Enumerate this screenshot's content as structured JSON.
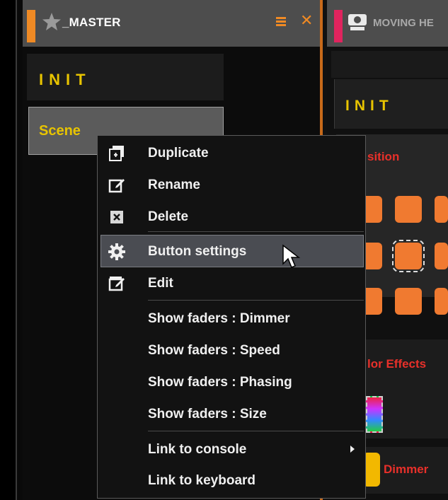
{
  "left_panel": {
    "title": "_MASTER",
    "buttons": [
      {
        "label": "INIT"
      },
      {
        "label": "Scene"
      }
    ],
    "accent_color": "#f08a24"
  },
  "right_panel": {
    "title": "MOVING HE",
    "init_label": "INIT",
    "position_label": "sition",
    "color_effects_label": "lor Effects",
    "dimmer_label": "Dimmer",
    "accent_color": "#e0245e"
  },
  "context_menu": {
    "items": [
      {
        "label": "Duplicate",
        "icon": "duplicate-icon"
      },
      {
        "label": "Rename",
        "icon": "rename-icon"
      },
      {
        "label": "Delete",
        "icon": "delete-icon"
      },
      {
        "label": "Button settings",
        "icon": "gear-icon",
        "highlighted": true
      },
      {
        "label": "Edit",
        "icon": "edit-icon"
      },
      {
        "label": "Show faders : Dimmer"
      },
      {
        "label": "Show faders : Speed"
      },
      {
        "label": "Show faders : Phasing"
      },
      {
        "label": "Show faders : Size"
      },
      {
        "label": "Link to console",
        "submenu": true
      },
      {
        "label": "Link to keyboard"
      }
    ]
  }
}
